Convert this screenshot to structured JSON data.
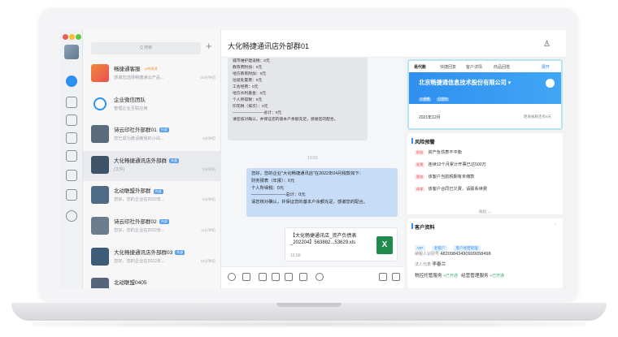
{
  "search": {
    "placeholder": "Q 搜索"
  },
  "conversations": [
    {
      "title": "畅捷通客服",
      "tag": "@畅捷通",
      "sub": "感谢您选择畅捷通云产品...",
      "time": "05分钟前"
    },
    {
      "title": "企业微信团队",
      "tag": "",
      "sub": "管理企业互联应用",
      "time": ""
    },
    {
      "title": "诗云印社外部群01",
      "tag": "外部",
      "sub": "您已成功邀请微信的小白...",
      "time": "3分钟前"
    },
    {
      "title": "大化畅捷通讯店外部群",
      "tag": "外部",
      "sub": "[文件]",
      "time": "3分钟前"
    },
    {
      "title": "北动联盟外部群",
      "tag": "外部",
      "sub": "您好，您的企业在2022年...",
      "time": "6分钟前"
    },
    {
      "title": "诗云印社外部群02",
      "tag": "外部",
      "sub": "您好，您的企业在2022年...",
      "time": "11分钟前"
    },
    {
      "title": "大化畅捷通讯店外部群03",
      "tag": "外部",
      "sub": "您好，您的企业在2022年...",
      "time": "15分钟前"
    },
    {
      "title": "北动联盟0405",
      "tag": "",
      "sub": "今天上午一定要把这个季...",
      "time": "21分钟前"
    }
  ],
  "chat": {
    "title": "大化畅捷通讯店外部群01",
    "gray_lines": [
      "城市维护建设税：0元",
      "教育费附加：0元",
      "地方教育附加：0元",
      "垃圾处置费：0元",
      "工会经费：0元",
      "地方水利基金：0元",
      "个人所得税：0元",
      "印花税（按次）：0元",
      "————————总计：0元",
      "请您核对确认，并保证您的基本户余额充足，感谢您的配合。"
    ],
    "time_label": "10:55",
    "blue_lines": [
      "您好，您的企业\"大化畅捷通讯店\"在2022年04月税款如下：",
      "财务报表（年报）：0元",
      "个人所得税：0元",
      "————————总计：0元",
      "请您核对确认，并保证您的基本户余额充足，感谢您的配合。"
    ],
    "file": {
      "name": "【大化畅捷通讯店_资产负债表_202204】563882...53629.xls",
      "size": "10.5K",
      "icon": "X"
    }
  },
  "right_panel": {
    "tabs": [
      "易代账",
      "快捷回复",
      "客户详情",
      "商品回搭",
      "展开"
    ],
    "company": "北京畅捷通信息技术股份有限公司 ▾",
    "badges": [
      "小规模",
      "已签约"
    ],
    "date": "2021年12月",
    "date_info": "距离报税还有6天",
    "risk": {
      "title": "风险预警",
      "items": [
        {
          "tag": "财务",
          "text": "资产负债表不平衡"
        },
        {
          "tag": "发票",
          "text": "连续12个月累计开票已达500万"
        },
        {
          "tag": "税务",
          "text": "该客户当前税期有未缴款"
        },
        {
          "tag": "成本",
          "text": "该客户合同已欠费，请联系续费"
        }
      ],
      "collapse": "收起 ︿"
    },
    "customer": {
      "title": "客户资料",
      "tags": [
        "VIP",
        "老客户",
        "客户经营管理"
      ],
      "tax_id_label": "纳税人识别号",
      "tax_id": "4820984349090905849​8",
      "legal_label": "法人代表",
      "legal": "李春兰",
      "services": [
        {
          "name": "税控托管服务",
          "status": "+已开通"
        },
        {
          "name": "经营管理服务",
          "status": "+已开通"
        }
      ]
    }
  }
}
